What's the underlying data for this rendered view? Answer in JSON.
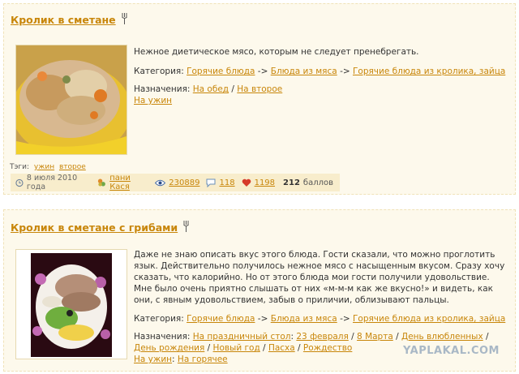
{
  "recipes": [
    {
      "title": "Кролик в сметане",
      "description": "Нежное диетическое мясо, которым не следует пренебрегать.",
      "category_label": "Категория:",
      "categories": [
        "Горячие блюда",
        "Блюда из мяса",
        "Горячие блюда из кролика, зайца"
      ],
      "category_sep": "->",
      "purpose_label": "Назначения:",
      "purposes": [
        "На обед",
        "На второе",
        "На ужин"
      ],
      "tags_label": "Тэги:",
      "tags": [
        "ужин",
        "второе"
      ],
      "date": "8 июля 2010 года",
      "author": "пани Кася",
      "views": "230889",
      "comments": "118",
      "likes": "1198",
      "score": "212",
      "score_unit": "баллов"
    },
    {
      "title": "Кролик в сметане с грибами",
      "description": "Даже не знаю описать вкус этого блюда. Гости сказали, что можно проглотить язык. Действительно получилось нежное мясо с насыщенным вкусом. Сразу хочу сказать, что калорийно. Но от этого блюда мои гости получили удовольствие. Мне было очень приятно слышать от них «м-м-м как же вкусно!» и видеть, как они, с явным удовольствием, забыв о приличии, облизывают пальцы.",
      "category_label": "Категория:",
      "categories": [
        "Горячие блюда",
        "Блюда из мяса",
        "Горячие блюда из кролика, зайца"
      ],
      "purpose_label": "Назначения:",
      "purposes_line1": [
        "На праздничный стол",
        "23 февраля",
        "8 Марта",
        "День влюбленных",
        "День рождения",
        "Новый год",
        "Пасха",
        "Рождество"
      ],
      "purposes_line2": [
        "На ужин",
        "На горячее"
      ]
    }
  ],
  "watermark": "YAPLAKAL.COM",
  "colors": {
    "link": "#c8860a",
    "card_bg": "#fdf9ec",
    "meta_bg": "#f8edcc"
  },
  "icons": [
    "fork-spoon-icon",
    "clock-icon",
    "user-icon",
    "eye-icon",
    "comment-icon",
    "heart-icon"
  ]
}
